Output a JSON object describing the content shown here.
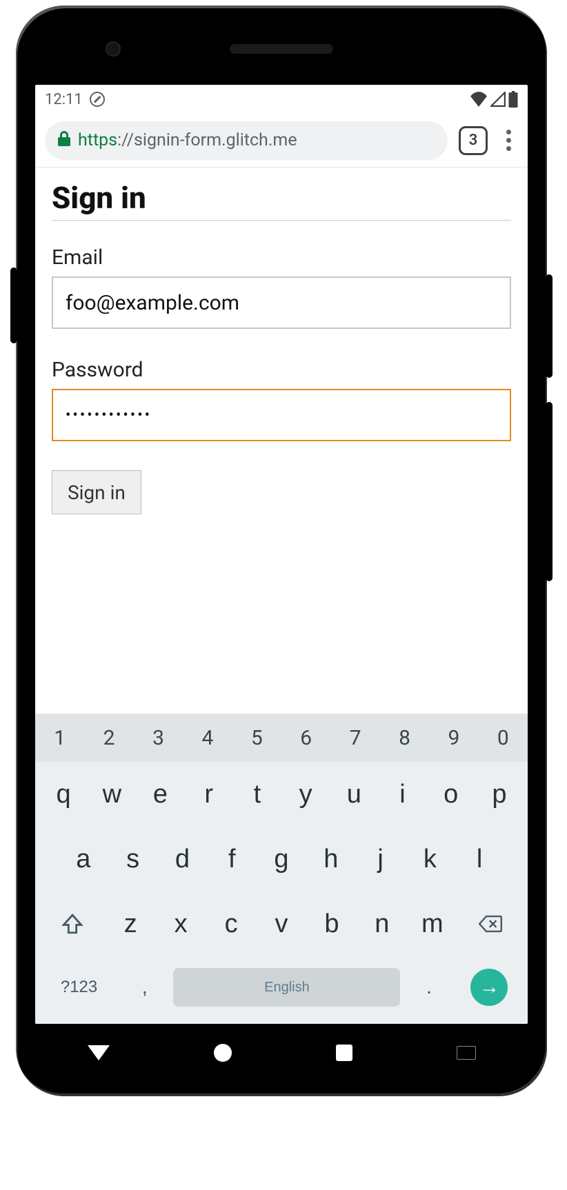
{
  "status": {
    "time": "12:11",
    "tabs": "3"
  },
  "url": {
    "scheme": "https",
    "sep": "://",
    "host": "signin-form.glitch.me"
  },
  "page": {
    "title": "Sign in",
    "email_label": "Email",
    "email_value": "foo@example.com",
    "password_label": "Password",
    "password_masked": "••••••••••••",
    "submit_label": "Sign in"
  },
  "keyboard": {
    "numbers": [
      "1",
      "2",
      "3",
      "4",
      "5",
      "6",
      "7",
      "8",
      "9",
      "0"
    ],
    "row1": [
      "q",
      "w",
      "e",
      "r",
      "t",
      "y",
      "u",
      "i",
      "o",
      "p"
    ],
    "row2": [
      "a",
      "s",
      "d",
      "f",
      "g",
      "h",
      "j",
      "k",
      "l"
    ],
    "row3": [
      "z",
      "x",
      "c",
      "v",
      "b",
      "n",
      "m"
    ],
    "sym": "?123",
    "comma": ",",
    "space": "English",
    "period": ".",
    "enter": "→"
  }
}
